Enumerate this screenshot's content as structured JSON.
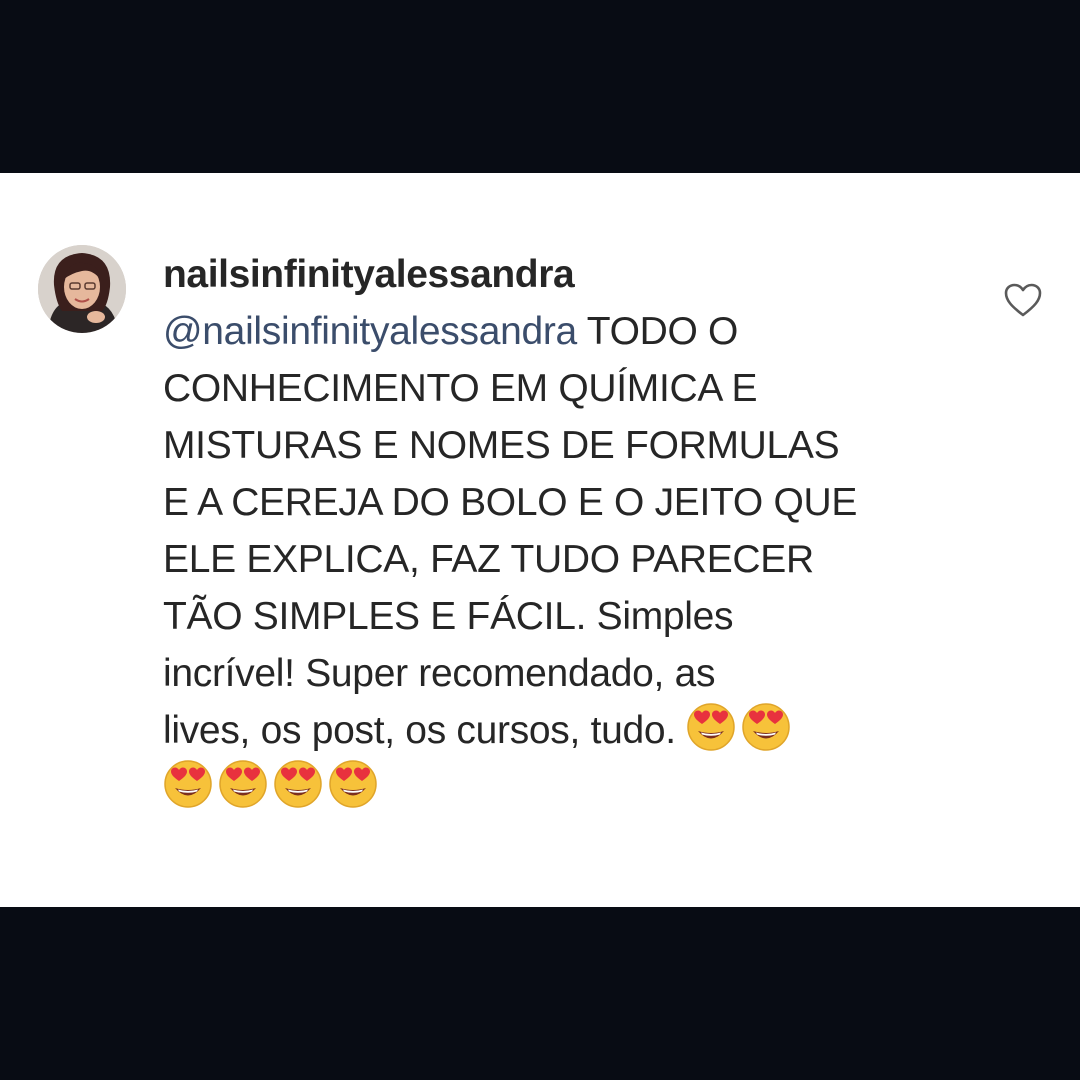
{
  "comment": {
    "username": "nailsinfinityalessandra",
    "mention": "@nailsinfinityalessandra",
    "lines": [
      " TODO O",
      "CONHECIMENTO EM QUÍMICA E",
      "MISTURAS E NOMES DE FORMULAS",
      "E A CEREJA DO BOLO E O JEITO QUE",
      "ELE EXPLICA, FAZ TUDO PARECER",
      "TÃO SIMPLES E FÁCIL. Simples",
      "incrível!  Super recomendado, as",
      "lives, os post, os cursos, tudo. "
    ],
    "emojis": [
      "😍",
      "😍",
      "😍",
      "😍",
      "😍",
      "😍"
    ]
  },
  "icons": {
    "like": "heart-icon",
    "emoji": "heart-eyes-emoji-icon"
  },
  "colors": {
    "band": "#080c14",
    "card": "#ffffff",
    "text": "#262626",
    "mention": "#3b4d6b",
    "emoji_face": "#f7c23a",
    "emoji_heart": "#e8323e"
  }
}
